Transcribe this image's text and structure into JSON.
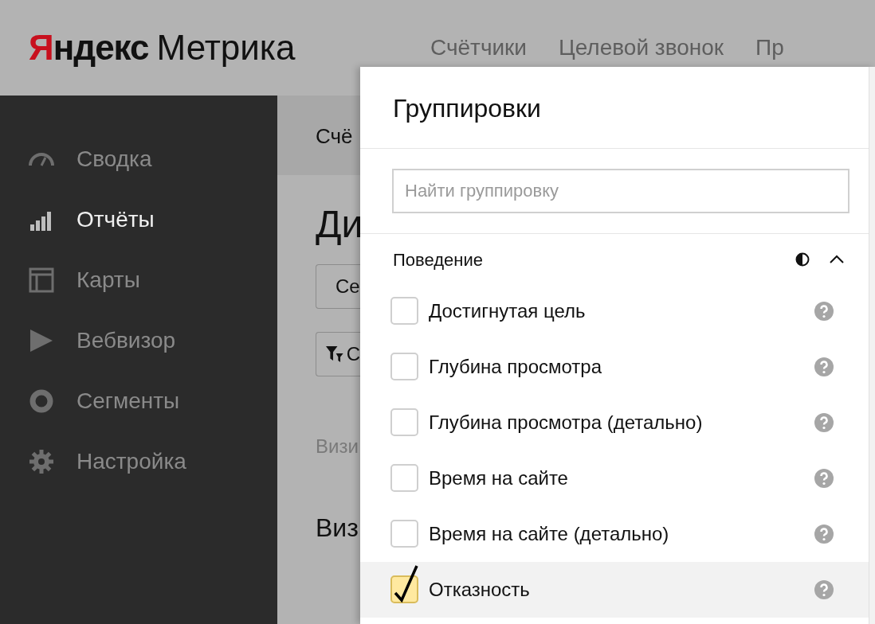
{
  "header": {
    "logo": {
      "brand": "Яндекс",
      "product": "Метрика"
    },
    "nav": [
      "Счётчики",
      "Целевой звонок",
      "Пр"
    ]
  },
  "sidebar": {
    "items": [
      {
        "label": "Сводка",
        "kind": "gauge",
        "selected": false
      },
      {
        "label": "Отчёты",
        "kind": "bars",
        "selected": true
      },
      {
        "label": "Карты",
        "kind": "layout",
        "selected": false
      },
      {
        "label": "Вебвизор",
        "kind": "play",
        "selected": false
      },
      {
        "label": "Сегменты",
        "kind": "ring",
        "selected": false
      },
      {
        "label": "Настройка",
        "kind": "gear",
        "selected": false
      }
    ]
  },
  "background": {
    "breadcrumb": "Счё",
    "heading": "Ди",
    "segment_button": "Се",
    "filter_button": "С",
    "caption": "Визи",
    "subheading": "Виз"
  },
  "panel": {
    "title": "Группировки",
    "search": {
      "placeholder": "Найти группировку"
    },
    "section": {
      "title": "Поведение",
      "expanded": true,
      "items": [
        {
          "label": "Достигнутая цель",
          "checked": false,
          "selected": false
        },
        {
          "label": "Глубина просмотра",
          "checked": false,
          "selected": false
        },
        {
          "label": "Глубина просмотра (детально)",
          "checked": false,
          "selected": false
        },
        {
          "label": "Время на сайте",
          "checked": false,
          "selected": false
        },
        {
          "label": "Время на сайте (детально)",
          "checked": false,
          "selected": false
        },
        {
          "label": "Отказность",
          "checked": true,
          "selected": true
        }
      ]
    }
  }
}
